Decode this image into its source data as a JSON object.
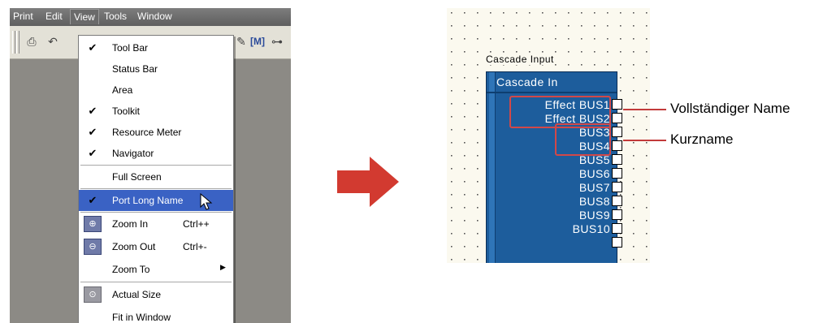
{
  "app": {
    "menubar": [
      "Print",
      "Edit",
      "View",
      "Tools",
      "Window"
    ]
  },
  "view_menu": {
    "items": [
      {
        "label": "Tool Bar",
        "checked": true
      },
      {
        "label": "Status Bar",
        "checked": false
      },
      {
        "label": "Area",
        "checked": false
      },
      {
        "label": "Toolkit",
        "checked": true
      },
      {
        "label": "Resource Meter",
        "checked": true
      },
      {
        "label": "Navigator",
        "checked": true
      },
      {
        "label": "Full Screen",
        "checked": false
      },
      {
        "label": "Port Long Name",
        "checked": true,
        "highlighted": true
      },
      {
        "label": "Zoom In",
        "shortcut": "Ctrl++",
        "icon": "zoom-in-icon"
      },
      {
        "label": "Zoom Out",
        "shortcut": "Ctrl+-",
        "icon": "zoom-out-icon"
      },
      {
        "label": "Zoom To",
        "submenu": true
      },
      {
        "label": "Actual Size",
        "icon": "actual-size-icon"
      },
      {
        "label": "Fit in Window"
      }
    ]
  },
  "component": {
    "title": "Cascade Input",
    "header": "Cascade In",
    "ports": [
      "Effect BUS1",
      "Effect BUS2",
      "BUS3",
      "BUS4",
      "BUS5",
      "BUS6",
      "BUS7",
      "BUS8",
      "BUS9",
      "BUS10"
    ]
  },
  "callouts": {
    "long_name": "Vollständiger Name",
    "short_name": "Kurzname"
  },
  "colors": {
    "highlight": "#3a62c4",
    "component_fill": "#1d5d9c",
    "callout_red": "#c23a3a",
    "arrow_red": "#d23a30"
  }
}
